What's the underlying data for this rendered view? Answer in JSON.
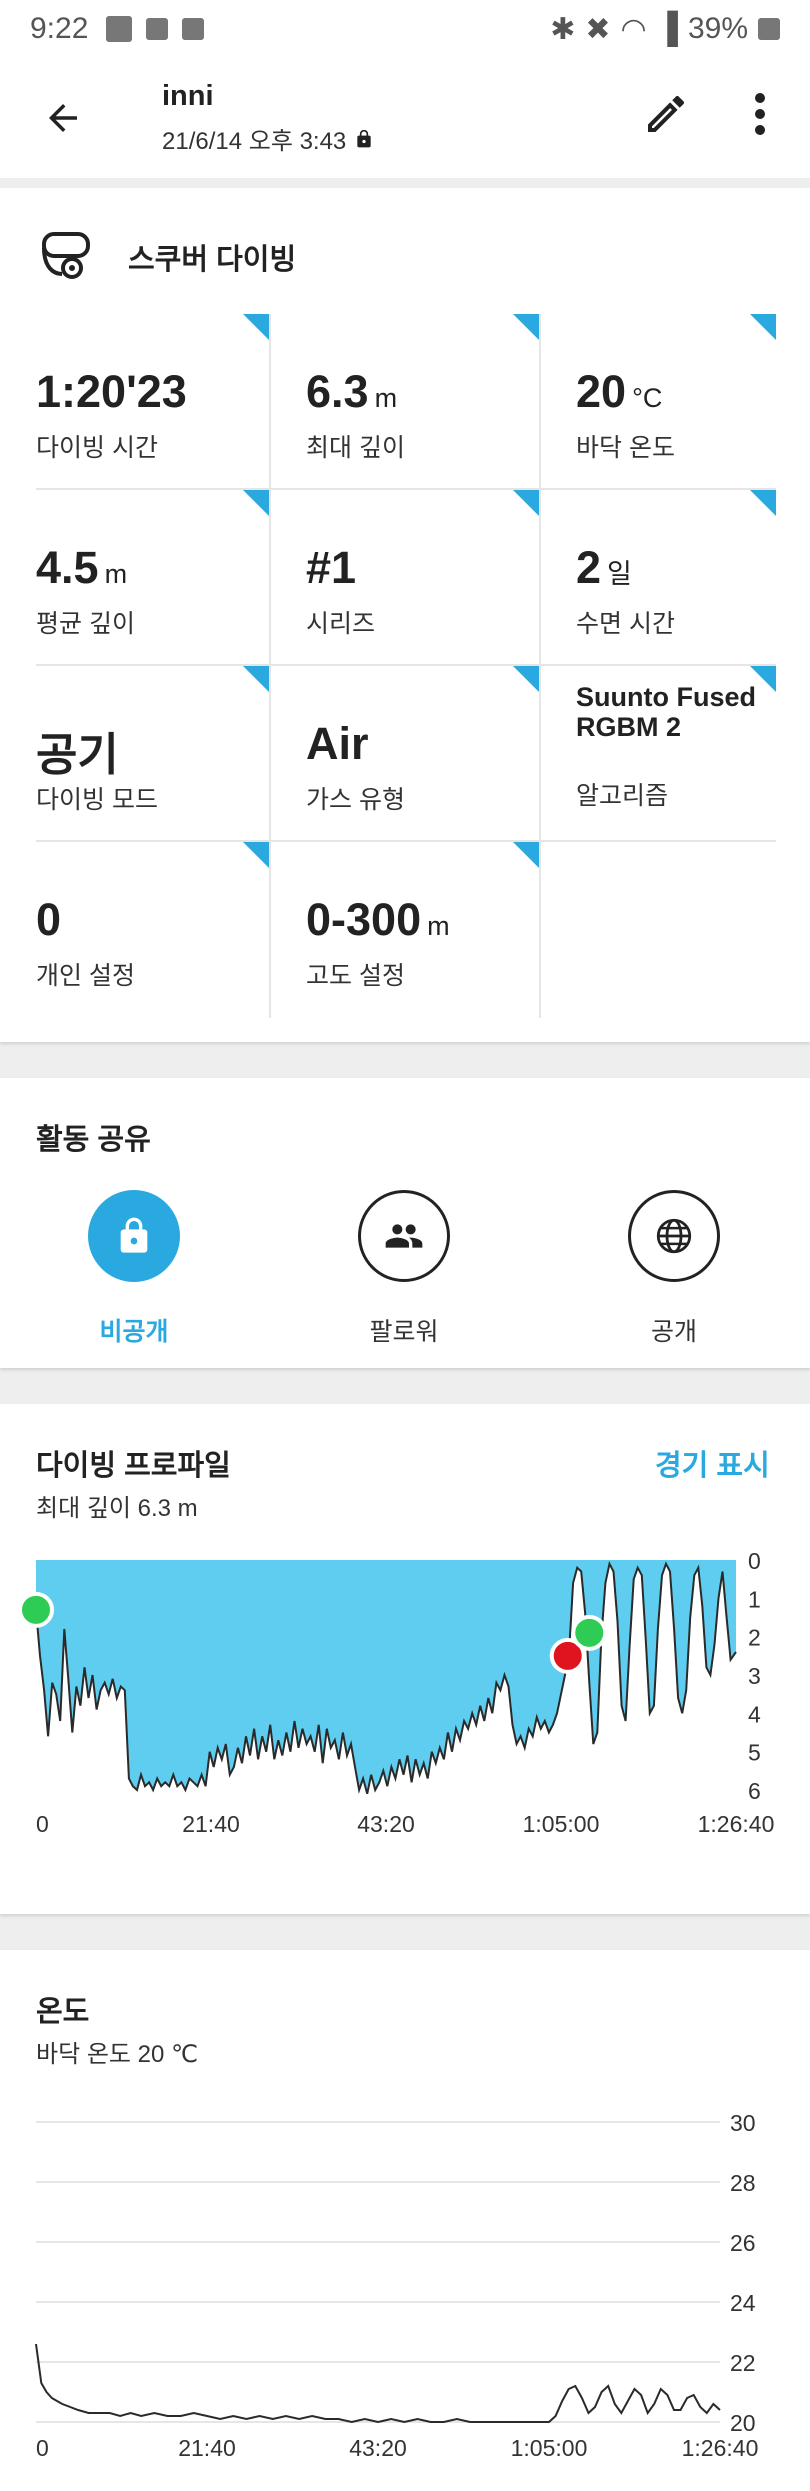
{
  "status_bar": {
    "time": "9:22",
    "battery": "39%"
  },
  "header": {
    "user": "inni",
    "subtitle": "21/6/14 오후 3:43"
  },
  "activity": {
    "name": "스쿠버 다이빙"
  },
  "stats": [
    {
      "value": "1:20'23",
      "unit": "",
      "label": "다이빙 시간"
    },
    {
      "value": "6.3",
      "unit": "m",
      "label": "최대 깊이"
    },
    {
      "value": "20",
      "unit": "°C",
      "label": "바닥 온도"
    },
    {
      "value": "4.5",
      "unit": "m",
      "label": "평균 깊이"
    },
    {
      "value": "#1",
      "unit": "",
      "label": "시리즈"
    },
    {
      "value": "2",
      "unit": "일",
      "label": "수면 시간"
    },
    {
      "value": "공기",
      "unit": "",
      "label": "다이빙 모드"
    },
    {
      "value": "Air",
      "unit": "",
      "label": "가스 유형"
    },
    {
      "value": "Suunto Fused RGBM 2",
      "unit": "",
      "label": "알고리즘"
    },
    {
      "value": "0",
      "unit": "",
      "label": "개인 설정"
    },
    {
      "value": "0-300",
      "unit": "m",
      "label": "고도 설정"
    }
  ],
  "sharing": {
    "title": "활동 공유",
    "options": [
      {
        "label": "비공개",
        "icon": "lock-icon",
        "selected": true
      },
      {
        "label": "팔로워",
        "icon": "people-icon",
        "selected": false
      },
      {
        "label": "공개",
        "icon": "globe-icon",
        "selected": false
      }
    ]
  },
  "profile": {
    "title": "다이빙 프로파일",
    "subtitle": "최대 깊이 6.3 m",
    "link": "경기 표시"
  },
  "temperature": {
    "title": "온도",
    "subtitle": "바닥 온도 20 ℃"
  },
  "colors": {
    "accent": "#29a9e0",
    "depth_fill": "#5fcdef",
    "alarm_green": "#2ecc55",
    "alarm_red": "#e0141e"
  },
  "chart_data": [
    {
      "type": "area",
      "x_ticks": [
        "0",
        "21:40",
        "43:20",
        "1:05:00",
        "1:26:40"
      ],
      "x_tick_seconds": [
        0,
        1300,
        2600,
        3900,
        5200
      ],
      "y_ticks": [
        "0",
        "1",
        "2",
        "3",
        "4",
        "5",
        "6"
      ],
      "ylim": [
        0,
        6
      ],
      "y_inverted": true,
      "x_range_seconds": [
        0,
        5200
      ],
      "points": [
        [
          0,
          1.3
        ],
        [
          30,
          2.5
        ],
        [
          60,
          3.4
        ],
        [
          90,
          4.6
        ],
        [
          120,
          3.2
        ],
        [
          150,
          3.5
        ],
        [
          180,
          4.2
        ],
        [
          210,
          1.8
        ],
        [
          240,
          3.1
        ],
        [
          270,
          4.5
        ],
        [
          300,
          3.3
        ],
        [
          330,
          3.8
        ],
        [
          360,
          2.8
        ],
        [
          390,
          3.6
        ],
        [
          420,
          3.0
        ],
        [
          450,
          3.9
        ],
        [
          480,
          3.4
        ],
        [
          510,
          3.2
        ],
        [
          540,
          3.5
        ],
        [
          570,
          3.1
        ],
        [
          600,
          3.6
        ],
        [
          630,
          3.3
        ],
        [
          660,
          3.4
        ],
        [
          690,
          5.7
        ],
        [
          720,
          5.9
        ],
        [
          750,
          6.0
        ],
        [
          780,
          5.6
        ],
        [
          810,
          5.9
        ],
        [
          840,
          5.8
        ],
        [
          870,
          6.0
        ],
        [
          900,
          5.7
        ],
        [
          930,
          5.9
        ],
        [
          960,
          5.8
        ],
        [
          990,
          5.9
        ],
        [
          1020,
          5.6
        ],
        [
          1050,
          5.9
        ],
        [
          1080,
          5.8
        ],
        [
          1110,
          6.0
        ],
        [
          1140,
          5.7
        ],
        [
          1170,
          5.8
        ],
        [
          1200,
          5.9
        ],
        [
          1230,
          5.6
        ],
        [
          1260,
          5.9
        ],
        [
          1290,
          5.0
        ],
        [
          1320,
          5.4
        ],
        [
          1350,
          4.9
        ],
        [
          1380,
          5.2
        ],
        [
          1410,
          4.8
        ],
        [
          1440,
          5.6
        ],
        [
          1470,
          5.4
        ],
        [
          1500,
          4.9
        ],
        [
          1530,
          5.3
        ],
        [
          1560,
          4.6
        ],
        [
          1590,
          5.1
        ],
        [
          1620,
          4.4
        ],
        [
          1650,
          5.2
        ],
        [
          1680,
          4.6
        ],
        [
          1710,
          5.0
        ],
        [
          1740,
          4.3
        ],
        [
          1770,
          5.2
        ],
        [
          1800,
          4.7
        ],
        [
          1830,
          5.1
        ],
        [
          1860,
          4.5
        ],
        [
          1890,
          5.0
        ],
        [
          1920,
          4.2
        ],
        [
          1950,
          4.9
        ],
        [
          1980,
          4.4
        ],
        [
          2010,
          4.8
        ],
        [
          2040,
          4.6
        ],
        [
          2070,
          5.0
        ],
        [
          2100,
          4.3
        ],
        [
          2130,
          5.3
        ],
        [
          2160,
          4.4
        ],
        [
          2190,
          4.9
        ],
        [
          2220,
          4.7
        ],
        [
          2250,
          5.2
        ],
        [
          2280,
          4.5
        ],
        [
          2310,
          5.1
        ],
        [
          2340,
          4.8
        ],
        [
          2370,
          5.4
        ],
        [
          2400,
          6.0
        ],
        [
          2430,
          5.7
        ],
        [
          2460,
          6.1
        ],
        [
          2490,
          5.6
        ],
        [
          2520,
          6.0
        ],
        [
          2550,
          5.8
        ],
        [
          2580,
          5.5
        ],
        [
          2610,
          5.9
        ],
        [
          2640,
          5.4
        ],
        [
          2670,
          5.7
        ],
        [
          2700,
          5.2
        ],
        [
          2730,
          5.6
        ],
        [
          2760,
          5.1
        ],
        [
          2790,
          5.8
        ],
        [
          2820,
          5.2
        ],
        [
          2850,
          5.6
        ],
        [
          2880,
          5.3
        ],
        [
          2910,
          5.7
        ],
        [
          2940,
          5.0
        ],
        [
          2970,
          5.3
        ],
        [
          3000,
          4.9
        ],
        [
          3030,
          5.2
        ],
        [
          3060,
          4.5
        ],
        [
          3090,
          5.0
        ],
        [
          3120,
          4.4
        ],
        [
          3150,
          4.7
        ],
        [
          3180,
          4.2
        ],
        [
          3210,
          4.4
        ],
        [
          3240,
          4.0
        ],
        [
          3270,
          4.3
        ],
        [
          3300,
          3.8
        ],
        [
          3330,
          4.2
        ],
        [
          3360,
          3.6
        ],
        [
          3390,
          4.0
        ],
        [
          3420,
          3.2
        ],
        [
          3450,
          3.4
        ],
        [
          3480,
          3.0
        ],
        [
          3510,
          3.3
        ],
        [
          3540,
          4.3
        ],
        [
          3570,
          4.8
        ],
        [
          3600,
          4.6
        ],
        [
          3630,
          4.9
        ],
        [
          3660,
          4.4
        ],
        [
          3690,
          4.6
        ],
        [
          3720,
          4.1
        ],
        [
          3750,
          4.4
        ],
        [
          3780,
          4.2
        ],
        [
          3810,
          4.5
        ],
        [
          3840,
          4.3
        ],
        [
          3870,
          4.0
        ],
        [
          3900,
          3.5
        ],
        [
          3930,
          3.0
        ],
        [
          3960,
          2.4
        ],
        [
          3990,
          0.6
        ],
        [
          4020,
          0.2
        ],
        [
          4050,
          0.3
        ],
        [
          4080,
          1.4
        ],
        [
          4110,
          3.2
        ],
        [
          4140,
          4.8
        ],
        [
          4170,
          4.5
        ],
        [
          4200,
          2.0
        ],
        [
          4230,
          0.6
        ],
        [
          4260,
          0.1
        ],
        [
          4290,
          0.3
        ],
        [
          4320,
          1.6
        ],
        [
          4350,
          3.8
        ],
        [
          4380,
          4.2
        ],
        [
          4410,
          2.2
        ],
        [
          4440,
          0.5
        ],
        [
          4470,
          0.2
        ],
        [
          4500,
          0.4
        ],
        [
          4530,
          2.1
        ],
        [
          4560,
          4.0
        ],
        [
          4590,
          3.8
        ],
        [
          4620,
          1.8
        ],
        [
          4650,
          0.4
        ],
        [
          4680,
          0.1
        ],
        [
          4710,
          0.3
        ],
        [
          4740,
          1.8
        ],
        [
          4770,
          3.6
        ],
        [
          4800,
          4.0
        ],
        [
          4830,
          3.4
        ],
        [
          4860,
          1.5
        ],
        [
          4890,
          0.4
        ],
        [
          4920,
          0.2
        ],
        [
          4950,
          1.2
        ],
        [
          4980,
          2.8
        ],
        [
          5010,
          3.0
        ],
        [
          5040,
          2.2
        ],
        [
          5070,
          1.0
        ],
        [
          5100,
          0.3
        ],
        [
          5130,
          1.5
        ],
        [
          5160,
          2.6
        ],
        [
          5200,
          2.4
        ]
      ],
      "markers": [
        {
          "x": 0,
          "y": 1.3,
          "color": "#2ecc55"
        },
        {
          "x": 3950,
          "y": 2.5,
          "color": "#e0141e"
        },
        {
          "x": 4110,
          "y": 1.9,
          "color": "#2ecc55"
        }
      ]
    },
    {
      "type": "line",
      "x_ticks": [
        "0",
        "21:40",
        "43:20",
        "1:05:00",
        "1:26:40"
      ],
      "x_tick_seconds": [
        0,
        1300,
        2600,
        3900,
        5200
      ],
      "y_ticks": [
        "30",
        "28",
        "26",
        "24",
        "22",
        "20"
      ],
      "ylim": [
        20,
        30
      ],
      "x_range_seconds": [
        0,
        5200
      ],
      "points": [
        [
          0,
          22.6
        ],
        [
          40,
          21.3
        ],
        [
          80,
          21.0
        ],
        [
          120,
          20.8
        ],
        [
          160,
          20.7
        ],
        [
          200,
          20.6
        ],
        [
          260,
          20.5
        ],
        [
          320,
          20.4
        ],
        [
          400,
          20.3
        ],
        [
          480,
          20.3
        ],
        [
          560,
          20.3
        ],
        [
          640,
          20.2
        ],
        [
          720,
          20.3
        ],
        [
          800,
          20.2
        ],
        [
          900,
          20.3
        ],
        [
          1000,
          20.2
        ],
        [
          1100,
          20.2
        ],
        [
          1200,
          20.3
        ],
        [
          1300,
          20.2
        ],
        [
          1400,
          20.1
        ],
        [
          1500,
          20.2
        ],
        [
          1600,
          20.1
        ],
        [
          1700,
          20.2
        ],
        [
          1800,
          20.1
        ],
        [
          1900,
          20.2
        ],
        [
          2000,
          20.1
        ],
        [
          2100,
          20.2
        ],
        [
          2200,
          20.1
        ],
        [
          2300,
          20.1
        ],
        [
          2400,
          20.0
        ],
        [
          2500,
          20.1
        ],
        [
          2600,
          20.0
        ],
        [
          2700,
          20.1
        ],
        [
          2800,
          20.0
        ],
        [
          2900,
          20.1
        ],
        [
          3000,
          20.0
        ],
        [
          3100,
          20.0
        ],
        [
          3200,
          20.1
        ],
        [
          3300,
          20.0
        ],
        [
          3400,
          20.0
        ],
        [
          3500,
          20.0
        ],
        [
          3600,
          20.0
        ],
        [
          3700,
          20.0
        ],
        [
          3800,
          20.0
        ],
        [
          3900,
          20.0
        ],
        [
          3950,
          20.2
        ],
        [
          4000,
          20.7
        ],
        [
          4050,
          21.1
        ],
        [
          4100,
          21.2
        ],
        [
          4150,
          20.8
        ],
        [
          4200,
          20.3
        ],
        [
          4250,
          20.5
        ],
        [
          4300,
          21.0
        ],
        [
          4350,
          21.2
        ],
        [
          4400,
          20.6
        ],
        [
          4450,
          20.3
        ],
        [
          4500,
          20.7
        ],
        [
          4550,
          21.1
        ],
        [
          4600,
          20.9
        ],
        [
          4650,
          20.3
        ],
        [
          4700,
          20.6
        ],
        [
          4750,
          21.1
        ],
        [
          4800,
          20.9
        ],
        [
          4850,
          20.4
        ],
        [
          4900,
          20.4
        ],
        [
          4950,
          20.8
        ],
        [
          5000,
          20.9
        ],
        [
          5050,
          20.5
        ],
        [
          5100,
          20.3
        ],
        [
          5150,
          20.6
        ],
        [
          5200,
          20.4
        ]
      ]
    }
  ]
}
